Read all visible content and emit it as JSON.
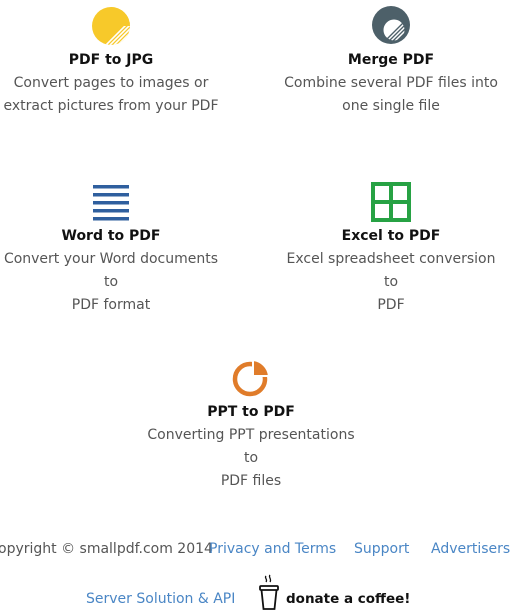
{
  "tools": [
    {
      "title": "PDF to JPG",
      "desc_line1": "Convert pages to images or",
      "desc_line2": "extract pictures from your PDF",
      "icon": "sun-icon",
      "color": "#f7c92a"
    },
    {
      "title": "Merge PDF",
      "desc_line1": "Combine several PDF files into",
      "desc_line2": "one single file",
      "icon": "merge-icon",
      "color": "#4d6069"
    },
    {
      "title": "Word to PDF",
      "desc_line1": "Convert your Word documents to",
      "desc_line2": "PDF format",
      "icon": "document-lines-icon",
      "color": "#2f5f9e"
    },
    {
      "title": "Excel to PDF",
      "desc_line1": "Excel spreadsheet conversion to",
      "desc_line2": "PDF",
      "icon": "spreadsheet-grid-icon",
      "color": "#27a244"
    },
    {
      "title": "PPT to PDF",
      "desc_line1": "Converting PPT presentations to",
      "desc_line2": "PDF files",
      "icon": "pie-chart-icon",
      "color": "#e07c2a"
    }
  ],
  "footer": {
    "copyright": "opyright © smallpdf.com 2014",
    "privacy": "Privacy and Terms",
    "support": "Support",
    "advertisers": "Advertisers",
    "server": "Server Solution & API",
    "donate": "donate a coffee!",
    "link_color": "#4a86c5"
  }
}
